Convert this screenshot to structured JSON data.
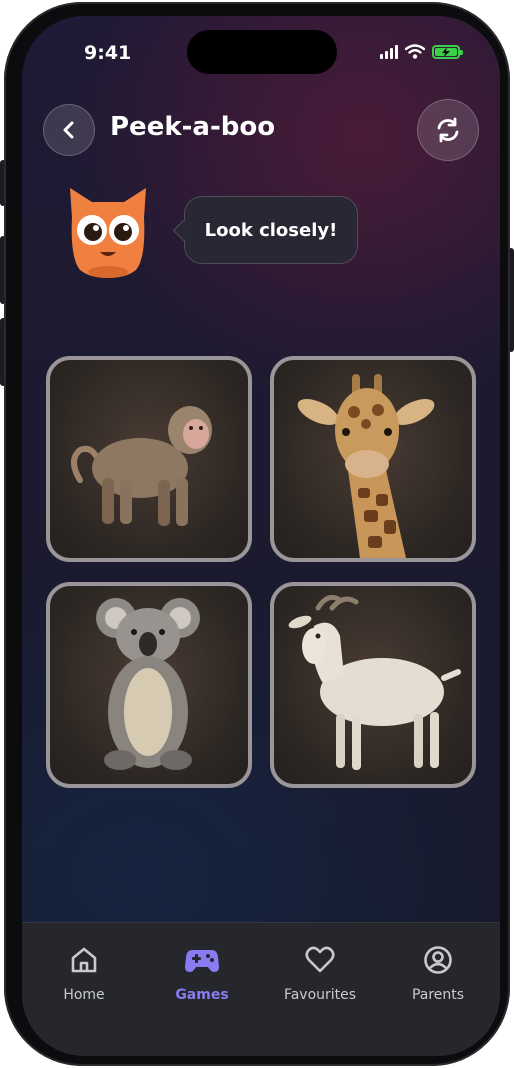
{
  "status": {
    "time": "9:41"
  },
  "header": {
    "title": "Peek-a-boo"
  },
  "mascot": {
    "speech": "Look closely!"
  },
  "animals": [
    {
      "name": "monkey",
      "icon": "monkey-photo"
    },
    {
      "name": "giraffe",
      "icon": "giraffe-photo"
    },
    {
      "name": "koala",
      "icon": "koala-photo"
    },
    {
      "name": "goat",
      "icon": "goat-photo"
    }
  ],
  "tabs": [
    {
      "label": "Home",
      "icon": "home-icon"
    },
    {
      "label": "Games",
      "icon": "gamepad-icon",
      "active": true
    },
    {
      "label": "Favourites",
      "icon": "heart-icon"
    },
    {
      "label": "Parents",
      "icon": "user-circle-icon"
    }
  ],
  "colors": {
    "accent": "#8a7cf0",
    "mascot": "#f08040",
    "battery": "#3ad14a"
  }
}
